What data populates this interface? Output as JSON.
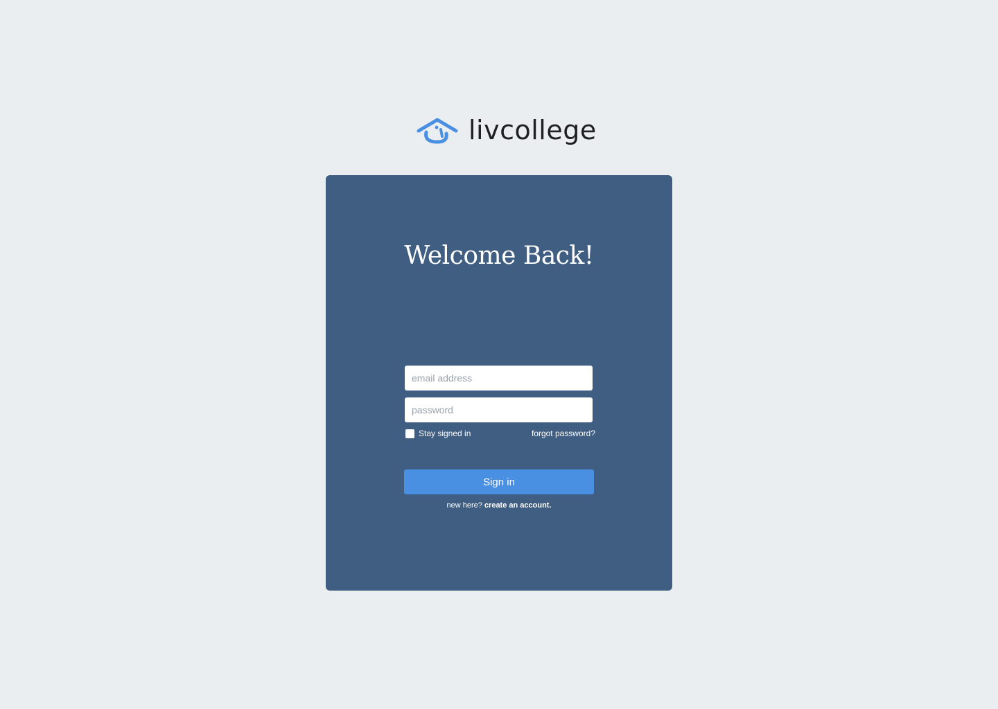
{
  "brand": {
    "name": "livcollege",
    "accent": "#4a90e2"
  },
  "card": {
    "title": "Welcome Back!"
  },
  "form": {
    "email_placeholder": "email address",
    "password_placeholder": "password",
    "stay_signed_in": "Stay signed in",
    "forgot_password": "forgot password?",
    "sign_in": "Sign in",
    "new_here": "new here?",
    "create_account": "create an account."
  }
}
